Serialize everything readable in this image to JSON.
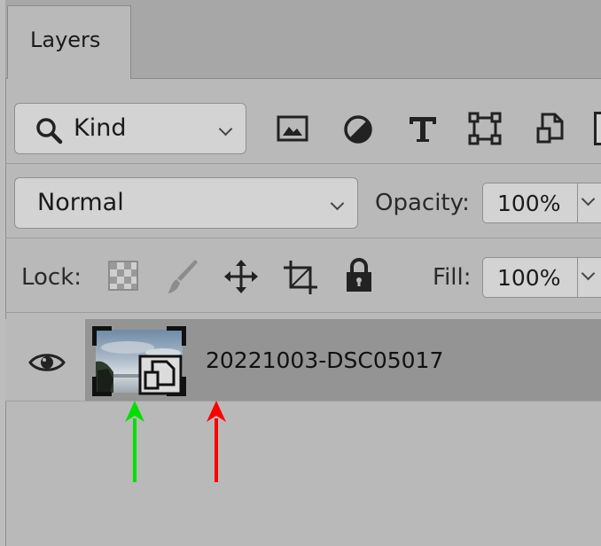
{
  "panel": {
    "tab_label": "Layers"
  },
  "filter": {
    "kind_label": "Kind",
    "filter_icons": [
      "image-filter-icon",
      "adjustment-filter-icon",
      "type-filter-icon",
      "shape-filter-icon",
      "smart-object-filter-icon"
    ]
  },
  "blend": {
    "mode": "Normal",
    "opacity_label": "Opacity:",
    "opacity_value": "100%"
  },
  "lock": {
    "label": "Lock:",
    "lock_icons": [
      "lock-transparent-pixels-icon",
      "lock-image-pixels-icon",
      "lock-position-icon",
      "lock-artboard-icon",
      "lock-all-icon"
    ],
    "fill_label": "Fill:",
    "fill_value": "100%"
  },
  "layer": {
    "name": "20221003-DSC05017",
    "visible": true,
    "type": "smart-object"
  },
  "annotations": {
    "green_arrow_color": "#00e000",
    "red_arrow_color": "#ff0000"
  }
}
